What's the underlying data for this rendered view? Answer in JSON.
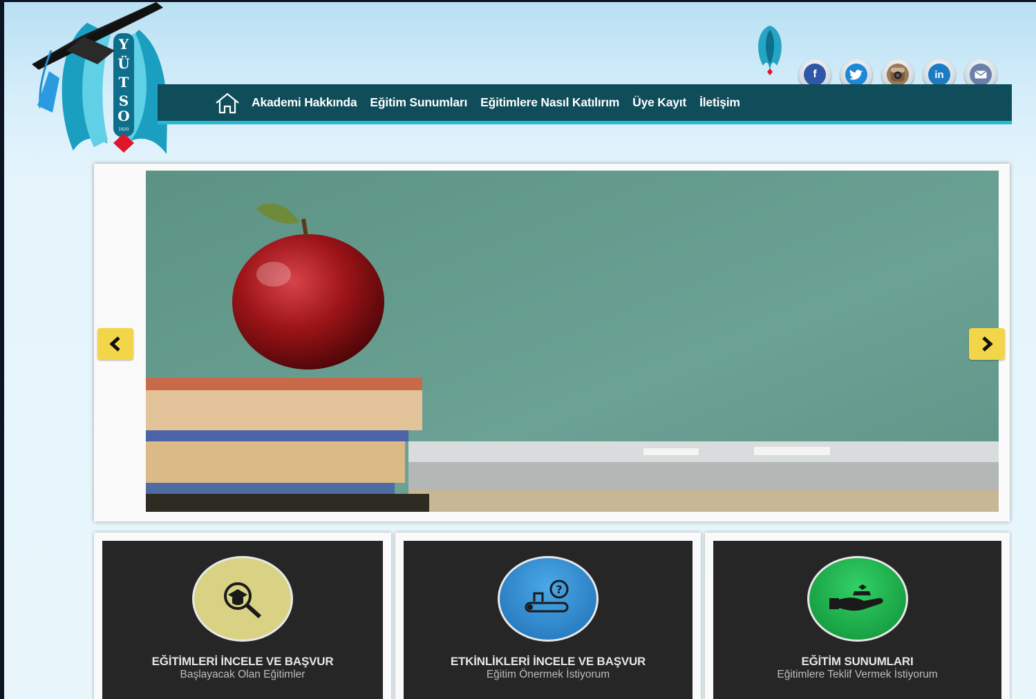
{
  "logo": {
    "letters": [
      "Y",
      "Ü",
      "T",
      "S",
      "O"
    ],
    "year": "1920"
  },
  "nav": {
    "items": [
      {
        "label": "Akademi Hakkında"
      },
      {
        "label": "Eğitim Sunumları"
      },
      {
        "label": "Eğitimlere Nasıl Katılırım"
      },
      {
        "label": "Üye Kayıt"
      },
      {
        "label": "İletişim"
      }
    ]
  },
  "social": [
    "facebook-icon",
    "twitter-icon",
    "instagram-icon",
    "linkedin-icon",
    "email-icon"
  ],
  "cards": [
    {
      "title": "EĞİTİMLERİ İNCELE VE BAŞVUR",
      "subtitle": "Başlayacak Olan Eğitimler",
      "color": "#d9d184",
      "icon": "graduation-search-icon"
    },
    {
      "title": "ETKİNLİKLERİ İNCELE VE BAŞVUR",
      "subtitle": "Eğitim Önermek İstiyorum",
      "color": "#2f8ed0",
      "icon": "diploma-question-icon"
    },
    {
      "title": "EĞİTİM SUNUMLARI",
      "subtitle": "Eğitimlere Teklif Vermek İstiyorum",
      "color": "#1bb34a",
      "icon": "hand-offer-icon"
    }
  ],
  "colors": {
    "navbar": "#0f4d5a",
    "navbar_accent": "#27b8d4",
    "arrow": "#f3d54a",
    "card_bg": "#262626"
  }
}
